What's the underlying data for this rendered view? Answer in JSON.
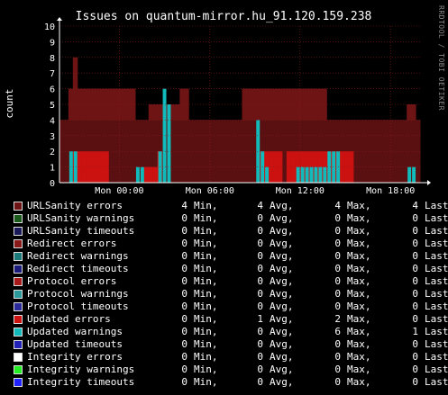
{
  "chart_data": {
    "type": "area",
    "title": "Issues on quantum-mirror.hu_91.120.159.238",
    "ylabel": "count",
    "xlabel": "",
    "ylim": [
      0,
      10
    ],
    "yticks": [
      "0",
      "1",
      "2",
      "3",
      "4",
      "5",
      "6",
      "7",
      "8",
      "9",
      "10"
    ],
    "xticks": [
      "Mon 00:00",
      "Mon 06:00",
      "Mon 12:00",
      "Mon 18:00"
    ],
    "grid": true,
    "watermark": "RRDTOOL / TOBI OETIKER",
    "colors": {
      "background": "#000000",
      "plot_area": "#000000",
      "grid": "#8a1c1c",
      "urlsanity_errors": "#6e1414",
      "urlsanity_errors_stack": "#5a1010",
      "updated_errors": "#cc1111",
      "updated_warnings": "#11bbbb"
    },
    "series": [
      {
        "name": "URLSanity errors",
        "color": "#6e1414",
        "segments": [
          [
            0,
            4
          ],
          [
            1,
            4
          ],
          [
            2,
            6
          ],
          [
            3,
            8
          ],
          [
            4,
            6
          ],
          [
            5,
            6
          ],
          [
            6,
            6
          ],
          [
            7,
            6
          ],
          [
            8,
            6
          ],
          [
            9,
            6
          ],
          [
            10,
            6
          ],
          [
            11,
            6
          ],
          [
            12,
            6
          ],
          [
            13,
            6
          ],
          [
            14,
            6
          ],
          [
            15,
            6
          ],
          [
            16,
            6
          ],
          [
            17,
            4
          ],
          [
            18,
            4
          ],
          [
            19,
            4
          ],
          [
            20,
            5
          ],
          [
            21,
            5
          ],
          [
            22,
            5
          ],
          [
            23,
            5
          ],
          [
            24,
            5
          ],
          [
            25,
            5
          ],
          [
            26,
            5
          ],
          [
            27,
            6
          ],
          [
            28,
            6
          ],
          [
            29,
            4
          ],
          [
            30,
            4
          ],
          [
            31,
            4
          ],
          [
            32,
            4
          ],
          [
            33,
            4
          ],
          [
            34,
            4
          ],
          [
            35,
            4
          ],
          [
            36,
            4
          ],
          [
            37,
            4
          ],
          [
            38,
            4
          ],
          [
            39,
            4
          ],
          [
            40,
            4
          ],
          [
            41,
            6
          ],
          [
            42,
            6
          ],
          [
            43,
            6
          ],
          [
            44,
            6
          ],
          [
            45,
            6
          ],
          [
            46,
            6
          ],
          [
            47,
            6
          ],
          [
            48,
            6
          ],
          [
            49,
            6
          ],
          [
            50,
            6
          ],
          [
            51,
            6
          ],
          [
            52,
            6
          ],
          [
            53,
            6
          ],
          [
            54,
            6
          ],
          [
            55,
            6
          ],
          [
            56,
            6
          ],
          [
            57,
            6
          ],
          [
            58,
            6
          ],
          [
            59,
            6
          ],
          [
            60,
            4
          ],
          [
            61,
            4
          ],
          [
            62,
            4
          ],
          [
            63,
            4
          ],
          [
            64,
            4
          ],
          [
            65,
            4
          ],
          [
            66,
            4
          ],
          [
            67,
            4
          ],
          [
            68,
            4
          ],
          [
            69,
            4
          ],
          [
            70,
            4
          ],
          [
            71,
            4
          ],
          [
            72,
            4
          ],
          [
            73,
            4
          ],
          [
            74,
            4
          ],
          [
            75,
            4
          ],
          [
            76,
            4
          ],
          [
            77,
            4
          ],
          [
            78,
            5
          ],
          [
            79,
            5
          ],
          [
            80,
            4
          ]
        ]
      },
      {
        "name": "Updated errors",
        "color": "#cc1111",
        "segments": [
          [
            0,
            0
          ],
          [
            1,
            0
          ],
          [
            2,
            0
          ],
          [
            3,
            2
          ],
          [
            4,
            2
          ],
          [
            5,
            2
          ],
          [
            6,
            2
          ],
          [
            7,
            2
          ],
          [
            8,
            2
          ],
          [
            9,
            2
          ],
          [
            10,
            2
          ],
          [
            11,
            0
          ],
          [
            12,
            0
          ],
          [
            13,
            0
          ],
          [
            14,
            0
          ],
          [
            15,
            0
          ],
          [
            16,
            0
          ],
          [
            17,
            0
          ],
          [
            18,
            0
          ],
          [
            19,
            1
          ],
          [
            20,
            1
          ],
          [
            21,
            1
          ],
          [
            22,
            2
          ],
          [
            23,
            0
          ],
          [
            24,
            0
          ],
          [
            25,
            0
          ],
          [
            26,
            0
          ],
          [
            27,
            0
          ],
          [
            28,
            0
          ],
          [
            29,
            0
          ],
          [
            30,
            0
          ],
          [
            31,
            0
          ],
          [
            32,
            0
          ],
          [
            33,
            0
          ],
          [
            34,
            0
          ],
          [
            35,
            0
          ],
          [
            36,
            0
          ],
          [
            37,
            0
          ],
          [
            38,
            0
          ],
          [
            39,
            0
          ],
          [
            40,
            0
          ],
          [
            41,
            0
          ],
          [
            42,
            0
          ],
          [
            43,
            0
          ],
          [
            44,
            0
          ],
          [
            45,
            2
          ],
          [
            46,
            2
          ],
          [
            47,
            2
          ],
          [
            48,
            2
          ],
          [
            49,
            2
          ],
          [
            50,
            0
          ],
          [
            51,
            2
          ],
          [
            52,
            2
          ],
          [
            53,
            2
          ],
          [
            54,
            2
          ],
          [
            55,
            2
          ],
          [
            56,
            2
          ],
          [
            57,
            2
          ],
          [
            58,
            2
          ],
          [
            59,
            2
          ],
          [
            60,
            2
          ],
          [
            61,
            2
          ],
          [
            62,
            2
          ],
          [
            63,
            2
          ],
          [
            64,
            2
          ],
          [
            65,
            2
          ],
          [
            66,
            0
          ],
          [
            67,
            0
          ],
          [
            68,
            0
          ],
          [
            69,
            0
          ],
          [
            70,
            0
          ],
          [
            71,
            0
          ],
          [
            72,
            0
          ],
          [
            73,
            0
          ],
          [
            74,
            0
          ],
          [
            75,
            0
          ],
          [
            76,
            0
          ],
          [
            77,
            0
          ],
          [
            78,
            0
          ],
          [
            79,
            0
          ],
          [
            80,
            0
          ]
        ]
      },
      {
        "name": "Updated warnings",
        "color": "#11bbbb",
        "segments": [
          [
            0,
            0
          ],
          [
            1,
            0
          ],
          [
            2,
            2
          ],
          [
            3,
            2
          ],
          [
            4,
            0
          ],
          [
            5,
            0
          ],
          [
            6,
            0
          ],
          [
            7,
            0
          ],
          [
            8,
            0
          ],
          [
            9,
            0
          ],
          [
            10,
            0
          ],
          [
            11,
            0
          ],
          [
            12,
            0
          ],
          [
            13,
            0
          ],
          [
            14,
            0
          ],
          [
            15,
            0
          ],
          [
            16,
            0
          ],
          [
            17,
            1
          ],
          [
            18,
            1
          ],
          [
            19,
            0
          ],
          [
            20,
            0
          ],
          [
            21,
            0
          ],
          [
            22,
            2
          ],
          [
            23,
            6
          ],
          [
            24,
            5
          ],
          [
            25,
            0
          ],
          [
            26,
            0
          ],
          [
            27,
            0
          ],
          [
            28,
            0
          ],
          [
            29,
            0
          ],
          [
            30,
            0
          ],
          [
            31,
            0
          ],
          [
            32,
            0
          ],
          [
            33,
            0
          ],
          [
            34,
            0
          ],
          [
            35,
            0
          ],
          [
            36,
            0
          ],
          [
            37,
            0
          ],
          [
            38,
            0
          ],
          [
            39,
            0
          ],
          [
            40,
            0
          ],
          [
            41,
            0
          ],
          [
            42,
            0
          ],
          [
            43,
            0
          ],
          [
            44,
            4
          ],
          [
            45,
            2
          ],
          [
            46,
            1
          ],
          [
            47,
            0
          ],
          [
            48,
            0
          ],
          [
            49,
            0
          ],
          [
            50,
            0
          ],
          [
            51,
            0
          ],
          [
            52,
            0
          ],
          [
            53,
            1
          ],
          [
            54,
            1
          ],
          [
            55,
            1
          ],
          [
            56,
            1
          ],
          [
            57,
            1
          ],
          [
            58,
            1
          ],
          [
            59,
            1
          ],
          [
            60,
            2
          ],
          [
            61,
            2
          ],
          [
            62,
            2
          ],
          [
            63,
            0
          ],
          [
            64,
            0
          ],
          [
            65,
            0
          ],
          [
            66,
            0
          ],
          [
            67,
            0
          ],
          [
            68,
            0
          ],
          [
            69,
            0
          ],
          [
            70,
            0
          ],
          [
            71,
            0
          ],
          [
            72,
            0
          ],
          [
            73,
            0
          ],
          [
            74,
            0
          ],
          [
            75,
            0
          ],
          [
            76,
            0
          ],
          [
            77,
            0
          ],
          [
            78,
            1
          ],
          [
            79,
            1
          ],
          [
            80,
            0
          ]
        ]
      }
    ]
  },
  "legend": [
    {
      "label": "URLSanity errors",
      "color": "#6e1414",
      "min": "4",
      "avg": "4",
      "max": "4",
      "last": "4"
    },
    {
      "label": "URLSanity warnings",
      "color": "#1a5a1a",
      "min": "0",
      "avg": "0",
      "max": "0",
      "last": "0"
    },
    {
      "label": "URLSanity timeouts",
      "color": "#1a1a5a",
      "min": "0",
      "avg": "0",
      "max": "0",
      "last": "0"
    },
    {
      "label": "Redirect errors",
      "color": "#8a1a1a",
      "min": "0",
      "avg": "0",
      "max": "0",
      "last": "0"
    },
    {
      "label": "Redirect warnings",
      "color": "#1a7a7a",
      "min": "0",
      "avg": "0",
      "max": "0",
      "last": "0"
    },
    {
      "label": "Redirect timeouts",
      "color": "#1a1a7a",
      "min": "0",
      "avg": "0",
      "max": "0",
      "last": "0"
    },
    {
      "label": "Protocol errors",
      "color": "#aa1a1a",
      "min": "0",
      "avg": "0",
      "max": "0",
      "last": "0"
    },
    {
      "label": "Protocol warnings",
      "color": "#2a9a9a",
      "min": "0",
      "avg": "0",
      "max": "0",
      "last": "0"
    },
    {
      "label": "Protocol timeouts",
      "color": "#2a2a9a",
      "min": "0",
      "avg": "0",
      "max": "0",
      "last": "0"
    },
    {
      "label": "Updated errors",
      "color": "#cc1111",
      "min": "0",
      "avg": "1",
      "max": "2",
      "last": "0"
    },
    {
      "label": "Updated warnings",
      "color": "#11bbbb",
      "min": "0",
      "avg": "0",
      "max": "6",
      "last": "1"
    },
    {
      "label": "Updated timeouts",
      "color": "#2222bb",
      "min": "0",
      "avg": "0",
      "max": "0",
      "last": "0"
    },
    {
      "label": "Integrity errors",
      "color": "#ffffff",
      "min": "0",
      "avg": "0",
      "max": "0",
      "last": "0"
    },
    {
      "label": "Integrity warnings",
      "color": "#22ee22",
      "min": "0",
      "avg": "0",
      "max": "0",
      "last": "0"
    },
    {
      "label": "Integrity timeouts",
      "color": "#2222ff",
      "min": "0",
      "avg": "0",
      "max": "0",
      "last": "0"
    }
  ],
  "legend_units": {
    "min": "Min,",
    "avg": "Avg,",
    "max": "Max,",
    "last": "Last"
  }
}
